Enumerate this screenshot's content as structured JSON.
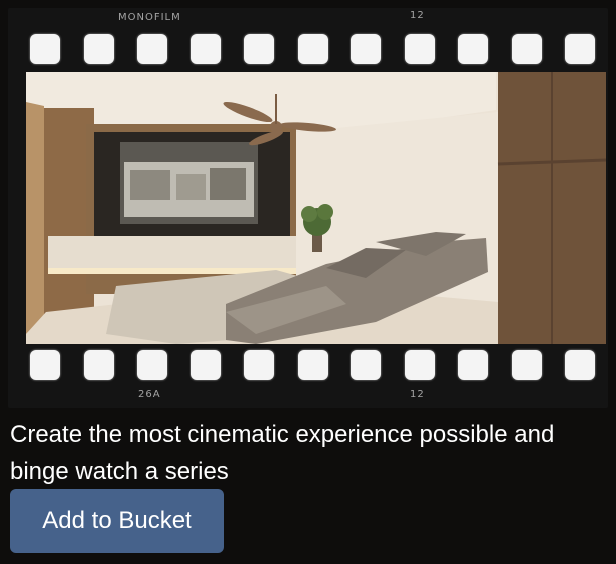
{
  "film_strip": {
    "top_brand": "MONOFILM",
    "top_number": "12",
    "bottom_code": "26A",
    "bottom_number": "12",
    "perforation_count": 11
  },
  "caption": "Create the most cinematic experience possible and binge watch a series",
  "button": {
    "label": "Add to Bucket"
  },
  "colors": {
    "background": "#0e0d0c",
    "button": "#46628b",
    "text": "#ffffff"
  }
}
